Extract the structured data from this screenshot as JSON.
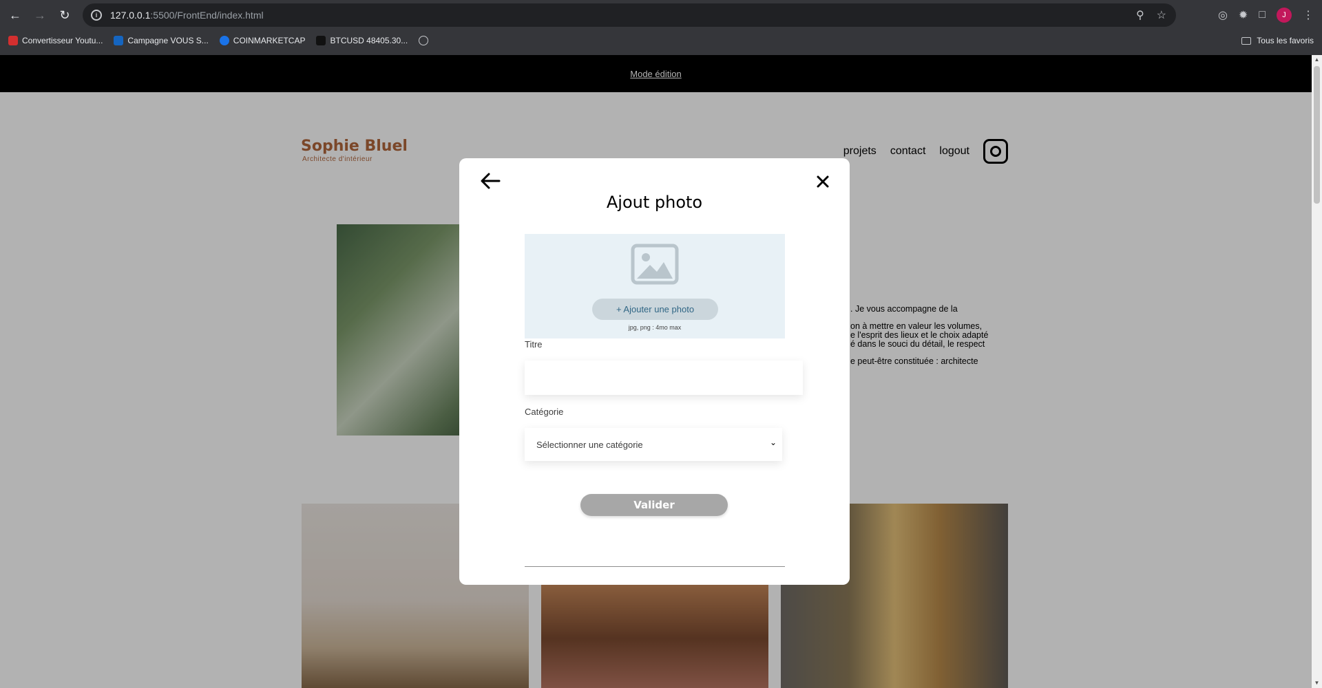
{
  "browser": {
    "url_host": "127.0.0.1",
    "url_path": ":5500/FrontEnd/index.html",
    "bookmarks": [
      {
        "label": "Convertisseur Youtu...",
        "color": "#d32f2f"
      },
      {
        "label": "Campagne VOUS S...",
        "color": "#1565c0"
      },
      {
        "label": "COINMARKETCAP",
        "color": "#1a73e8"
      },
      {
        "label": "BTCUSD 48405.30...",
        "color": "#111111"
      }
    ],
    "all_bookmarks_label": "Tous les favoris",
    "profile_initial": "J"
  },
  "page": {
    "edit_mode_label": "Mode édition",
    "logo_title": "Sophie Bluel",
    "logo_subtitle": "Architecte d'intérieur",
    "nav": [
      "projets",
      "contact",
      "logout"
    ],
    "intro_lines": [
      ". Je vous accompagne de la",
      "on à mettre en valeur les volumes,",
      "e l'esprit des lieux et le choix adapté",
      "é dans le souci du détail, le respect",
      "e peut-être constituée : architecte"
    ]
  },
  "modal": {
    "title": "Ajout photo",
    "add_photo_label": "+ Ajouter une photo",
    "file_hint": "jpg, png : 4mo max",
    "title_label": "Titre",
    "category_label": "Catégorie",
    "category_placeholder": "Sélectionner une catégorie",
    "submit_label": "Valider"
  }
}
